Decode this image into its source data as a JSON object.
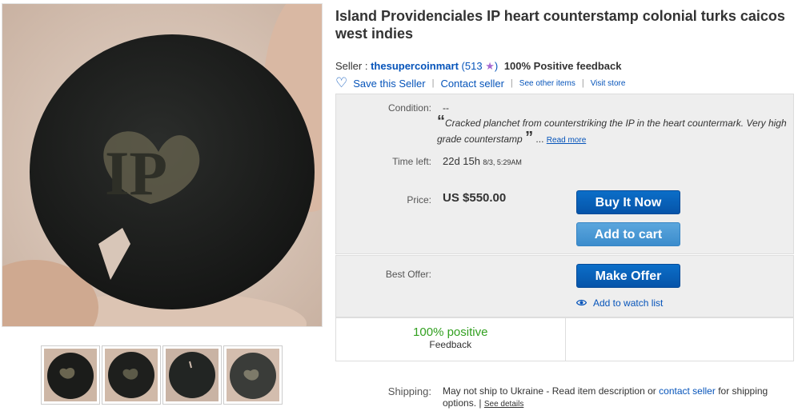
{
  "item": {
    "title": "Island Providenciales IP heart counterstamp colonial turks caicos west indies"
  },
  "coin": {
    "stamp_text": "IP"
  },
  "seller": {
    "label": "Seller :",
    "name": "thesupercoinmart",
    "count_open": "(513",
    "count_close": ")",
    "feedback": "100% Positive feedback"
  },
  "actions": {
    "save_seller": "Save this Seller",
    "contact_seller": "Contact seller",
    "see_other_items": "See other items",
    "visit_store": "Visit store",
    "separator": "|"
  },
  "condition": {
    "label": "Condition:",
    "value": "--",
    "quote_open": "“",
    "quote": "Cracked planchet from counterstriking the IP in the heart countermark. Very high grade counterstamp",
    "quote_close": "”",
    "ellipsis": "...",
    "read_more": "Read more"
  },
  "time_left": {
    "label": "Time left:",
    "value": "22d 15h",
    "detail": "8/3, 5:29AM"
  },
  "price": {
    "label": "Price:",
    "value": "US $550.00"
  },
  "buttons": {
    "buy_now": "Buy It Now",
    "add_to_cart": "Add to cart",
    "make_offer": "Make Offer",
    "watch_list": "Add to watch list"
  },
  "best_offer": {
    "label": "Best Offer:"
  },
  "feedback_box": {
    "percent": "100% positive",
    "label": "Feedback"
  },
  "shipping": {
    "label": "Shipping:",
    "text_before": "May not ship to Ukraine - Read item description or",
    "contact_link": "contact seller",
    "text_after": "for shipping options.",
    "sep": "|",
    "see_details": "See details"
  },
  "colors": {
    "link": "#0654ba",
    "button_primary": "#0654a9",
    "button_secondary": "#3b8ccc",
    "positive": "#32a020",
    "star": "#a66ad1"
  }
}
